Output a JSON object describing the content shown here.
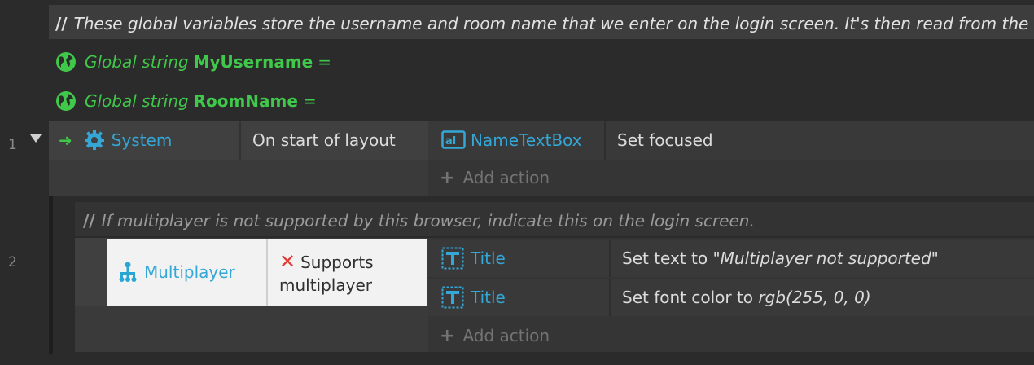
{
  "comment1": {
    "slashes": "//",
    "text": "These global variables store the username and room name that we enter on the login screen. It's then read from the 'Chat' la"
  },
  "globals": [
    {
      "prefix": "Global string",
      "name": "MyUsername",
      "suffix": "="
    },
    {
      "prefix": "Global string",
      "name": "RoomName",
      "suffix": "="
    }
  ],
  "event1": {
    "number": "1",
    "object": "System",
    "condition": "On start of layout",
    "action_object": "NameTextBox",
    "action_text": "Set focused",
    "add_action": "Add action"
  },
  "comment2": {
    "slashes": "//",
    "text": "If multiplayer is not supported by this browser, indicate this on the login screen."
  },
  "event2": {
    "number": "2",
    "object": "Multiplayer",
    "condition_line1": "Supports",
    "condition_line2": "multiplayer",
    "actions": [
      {
        "object": "Title",
        "text_prefix": "Set text to ",
        "value": "\"Multiplayer not supported\""
      },
      {
        "object": "Title",
        "text_prefix": "Set font color to ",
        "value": "rgb(255, 0, 0)"
      }
    ],
    "add_action": "Add action"
  },
  "colors": {
    "background": "#2b2b2b",
    "global_green": "#3fc84a",
    "object_cyan": "#34a7d6",
    "invert_red": "#e53935"
  }
}
